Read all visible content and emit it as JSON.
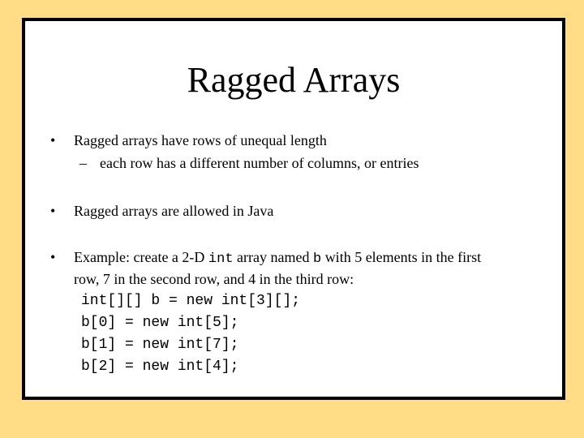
{
  "slide": {
    "title": "Ragged Arrays",
    "bullets": [
      {
        "marker": "•",
        "text": "Ragged arrays have rows of unequal length",
        "sub": {
          "marker": "–",
          "text": "each row has a different number of columns, or entries"
        }
      },
      {
        "marker": "•",
        "text": "Ragged arrays are allowed in Java"
      },
      {
        "marker": "•",
        "line1_part1": "Example: create a 2-D ",
        "line1_code1": "int",
        "line1_part2": " array named ",
        "line1_code2": "b",
        "line1_part3": " with 5 elements in the first",
        "line2": "row, 7 in the second row, and 4 in the third row:",
        "code": [
          "int[][] b = new int[3][];",
          "b[0] = new int[5];",
          "b[1] = new int[7];",
          "b[2] = new int[4];"
        ]
      }
    ]
  },
  "colors": {
    "background": "#FFDC85",
    "slide": "#FFFFFF",
    "border": "#000000",
    "text": "#000000"
  }
}
